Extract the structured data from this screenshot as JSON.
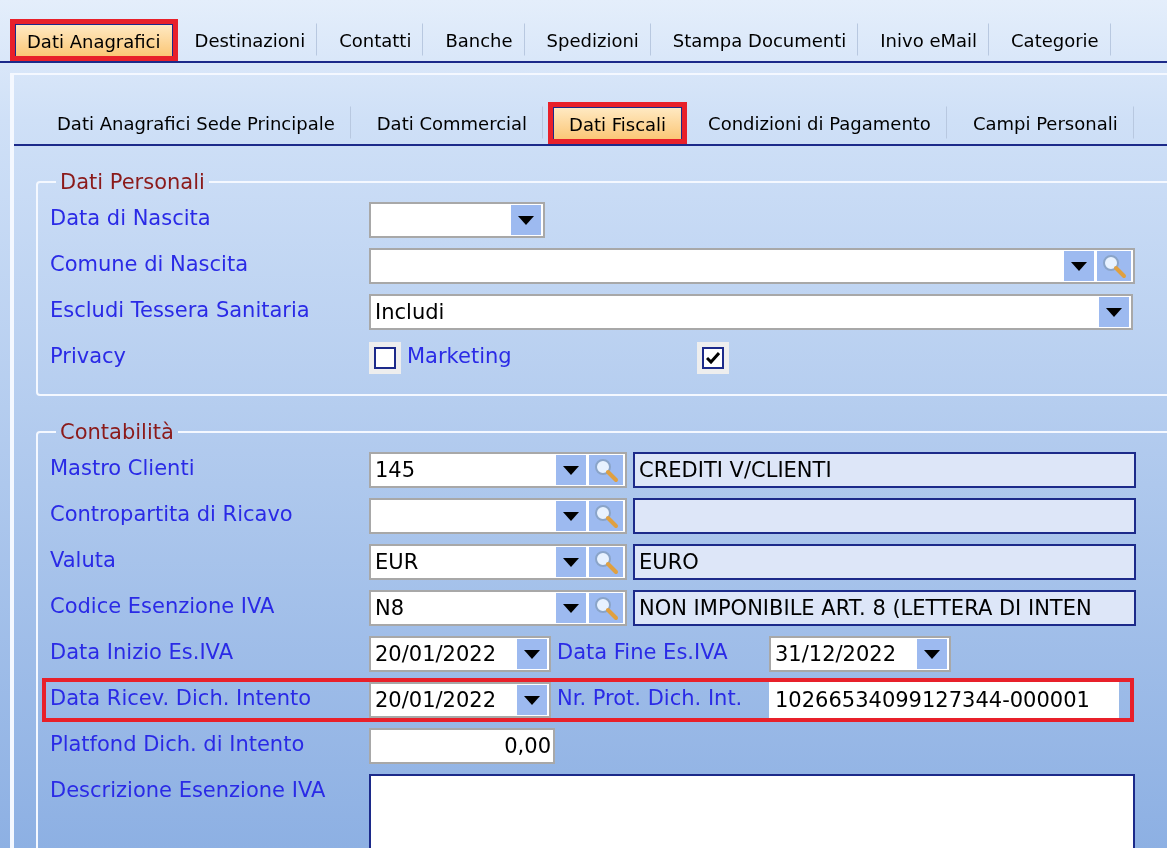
{
  "main_tabs": [
    {
      "label": "Dati Anagrafici",
      "selected": true,
      "highlighted": true
    },
    {
      "label": "Destinazioni",
      "selected": false,
      "highlighted": false
    },
    {
      "label": "Contatti",
      "selected": false,
      "highlighted": false
    },
    {
      "label": "Banche",
      "selected": false,
      "highlighted": false
    },
    {
      "label": "Spedizioni",
      "selected": false,
      "highlighted": false
    },
    {
      "label": "Stampa Documenti",
      "selected": false,
      "highlighted": false
    },
    {
      "label": "Inivo eMail",
      "selected": false,
      "highlighted": false
    },
    {
      "label": "Categorie",
      "selected": false,
      "highlighted": false
    }
  ],
  "sub_tabs": [
    {
      "label": "Dati Anagrafici Sede Principale",
      "selected": false,
      "highlighted": false
    },
    {
      "label": "Dati Commercial",
      "selected": false,
      "highlighted": false
    },
    {
      "label": "Dati Fiscali",
      "selected": true,
      "highlighted": true
    },
    {
      "label": "Condizioni di Pagamento",
      "selected": false,
      "highlighted": false
    },
    {
      "label": "Campi Personali",
      "selected": false,
      "highlighted": false
    }
  ],
  "groups": [
    {
      "title": "Dati Personali",
      "rows": [
        {
          "label": "Data di Nascita",
          "highlighted": false,
          "controls": [
            {
              "kind": "date"
            }
          ]
        },
        {
          "label": "Comune di Nascita",
          "highlighted": false,
          "controls": [
            {
              "kind": "combo_search"
            }
          ]
        },
        {
          "label": "Escludi Tessera Sanitaria",
          "highlighted": false,
          "controls": [
            {
              "kind": "combo",
              "value": "Includi"
            }
          ]
        },
        {
          "label": "Privacy",
          "highlighted": false,
          "controls": [
            {
              "kind": "checkbox",
              "checked": false
            },
            {
              "kind": "caption",
              "text": "Marketing"
            },
            {
              "kind": "checkbox",
              "checked": true
            }
          ]
        }
      ]
    },
    {
      "title": "Contabilità",
      "rows": [
        {
          "label": "Mastro Clienti",
          "highlighted": false,
          "controls": [
            {
              "kind": "lookup",
              "value": "145",
              "description": "CREDITI V/CLIENTI"
            }
          ]
        },
        {
          "label": "Contropartita di Ricavo",
          "highlighted": false,
          "controls": [
            {
              "kind": "lookup"
            }
          ]
        },
        {
          "label": "Valuta",
          "highlighted": false,
          "controls": [
            {
              "kind": "lookup",
              "value": "EUR",
              "description": "EURO"
            }
          ]
        },
        {
          "label": "Codice Esenzione IVA",
          "highlighted": false,
          "controls": [
            {
              "kind": "lookup",
              "value": "N8",
              "description": "NON IMPONIBILE ART. 8 (LETTERA DI INTEN"
            }
          ]
        },
        {
          "label": "Data Inizio Es.IVA",
          "highlighted": false,
          "controls": [
            {
              "kind": "date",
              "value": "20/01/2022"
            },
            {
              "kind": "caption",
              "text": "Data Fine Es.IVA"
            },
            {
              "kind": "date",
              "value": "31/12/2022"
            }
          ]
        },
        {
          "label": "Data Ricev. Dich. Intento",
          "highlighted": true,
          "controls": [
            {
              "kind": "date",
              "value": "20/01/2022"
            },
            {
              "kind": "caption",
              "text": "Nr. Prot. Dich. Int."
            },
            {
              "kind": "text",
              "value": "10266534099127344-000001"
            }
          ]
        },
        {
          "label": "Platfond Dich. di Intento",
          "highlighted": false,
          "controls": [
            {
              "kind": "amount",
              "value": "0,00"
            }
          ]
        },
        {
          "label": "Descrizione Esenzione IVA",
          "highlighted": false,
          "controls": [
            {
              "kind": "memo"
            }
          ]
        }
      ]
    }
  ]
}
